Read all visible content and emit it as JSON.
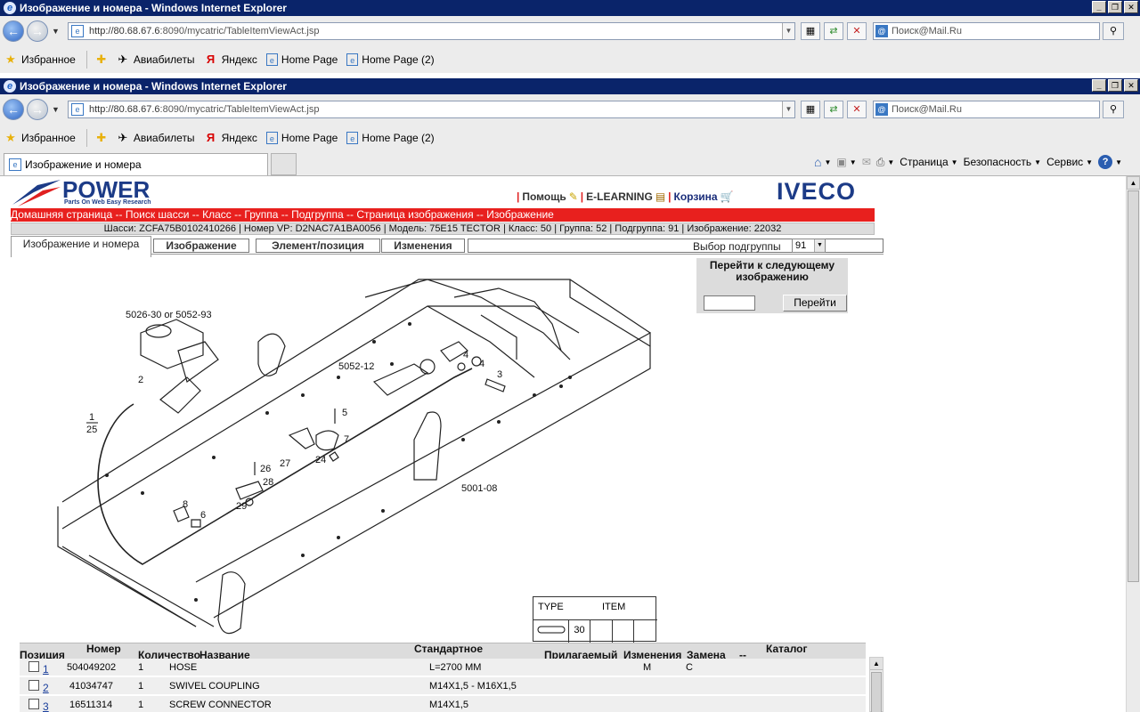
{
  "window": {
    "title": "Изображение и номера - Windows Internet Explorer",
    "url_host": "http://80.68.67.6",
    "url_path": ":8090/mycatric/TableItemViewAct.jsp",
    "search_placeholder": "Поиск@Mail.Ru"
  },
  "favorites": {
    "favorites_label": "Избранное",
    "items": [
      "Авиабилеты",
      "Яндекс",
      "Home Page",
      "Home Page (2)"
    ]
  },
  "tab": {
    "title": "Изображение и номера"
  },
  "commandbar": {
    "page": "Страница",
    "security": "Безопасность",
    "service": "Сервис"
  },
  "site": {
    "logo_word": "POWER",
    "logo_tagline": "Parts On Web Easy Research",
    "help": "Помощь",
    "elearning": "E-LEARNING",
    "cart": "Корзина",
    "brand": "IVECO",
    "breadcrumb": "Домашняя страница -- Поиск шасси -- Класс -- Группа -- Подгруппа -- Страница изображения -- Изображение",
    "info_line": "Шасси: ZCFA75B0102410266 | Номер VP: D2NAC7A1BA0056 | Модель: 75E15 TECTOR | Класс: 50 | Группа: 52 | Подгруппа: 91 | Изображение: 22032"
  },
  "page_tabs": {
    "active": "Изображение и номера",
    "image": "Изображение",
    "element": "Элемент/позиция",
    "changes": "Изменения",
    "subgroup_label": "Выбор подгруппы",
    "subgroup_value": "91"
  },
  "goto_box": {
    "title": "Перейти к следующему изображению",
    "button": "Перейти",
    "input_value": ""
  },
  "diagram_labels": {
    "l_5026": "5026-30  or  5052-93",
    "l_5052": "5052-12",
    "l_5001": "5001-08",
    "n1": "1",
    "n25": "25",
    "n2": "2",
    "n3": "3",
    "n4a": "4",
    "n4b": "4",
    "n5": "5",
    "n6": "6",
    "n7": "7",
    "n8": "8",
    "n24": "24",
    "n26": "26",
    "n27": "27",
    "n28": "28",
    "n29": "29"
  },
  "type_box": {
    "type": "TYPE",
    "item": "ITEM",
    "value": "30"
  },
  "table": {
    "headers": {
      "position": "Позиция",
      "number": "Номер",
      "quantity": "Количество",
      "name": "Название",
      "standard": "Стандартное",
      "attached": "Прилагаемый",
      "changes": "Изменения",
      "replacement": "Замена",
      "dash": "--",
      "catalog": "Каталог"
    },
    "rows": [
      {
        "pos": "1",
        "number": "504049202",
        "qty": "1",
        "name": "HOSE",
        "standard": "L=2700 MM",
        "changes": "M",
        "replacement": "C"
      },
      {
        "pos": "2",
        "number": "41034747",
        "qty": "1",
        "name": "SWIVEL COUPLING",
        "standard": "M14X1,5 - M16X1,5",
        "changes": "",
        "replacement": ""
      },
      {
        "pos": "3",
        "number": "16511314",
        "qty": "1",
        "name": "SCREW CONNECTOR",
        "standard": "M14X1,5",
        "changes": "",
        "replacement": ""
      }
    ]
  }
}
